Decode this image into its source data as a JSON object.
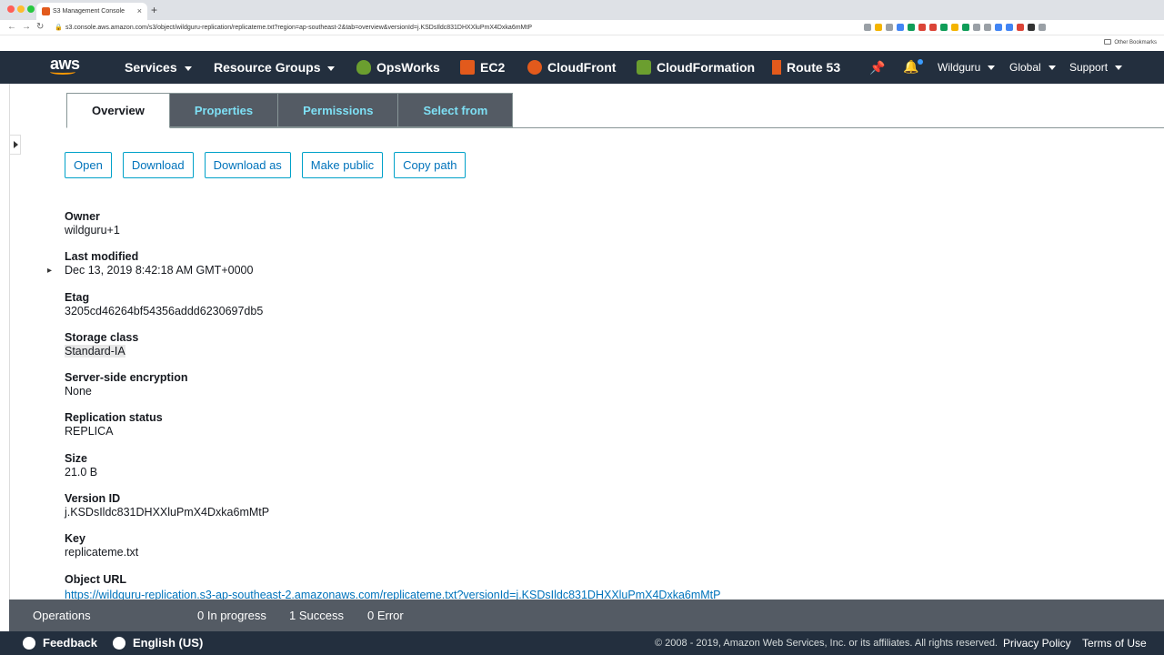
{
  "browser": {
    "tab_title": "S3 Management Console",
    "tab_close": "×",
    "new_tab": "+",
    "url": "s3.console.aws.amazon.com/s3/object/wildguru-replication/replicateme.txt?region=ap-southeast-2&tab=overview&versionId=j.KSDsIldc831DHXXluPmX4Dxka6mMtP",
    "bookmarks_label": "Other Bookmarks",
    "nav_back": "←",
    "nav_forward": "→",
    "nav_reload": "↻",
    "lock": "🔒",
    "extension_colors": [
      "#9aa0a6",
      "#f4b400",
      "#9aa0a6",
      "#4285f4",
      "#0f9d58",
      "#db4437",
      "#db4437",
      "#0f9d58",
      "#f4b400",
      "#0f9d58",
      "#9aa0a6",
      "#9aa0a6",
      "#4285f4",
      "#4285f4",
      "#db4437",
      "#333333",
      "#9aa0a6"
    ]
  },
  "aws_nav": {
    "logo_text": "aws",
    "services": "Services",
    "resource_groups": "Resource Groups",
    "shortcuts": [
      {
        "label": "OpsWorks",
        "icon": "opsworks-icon",
        "color": "#6b9e2f"
      },
      {
        "label": "EC2",
        "icon": "ec2-icon",
        "color": "#e25a1c"
      },
      {
        "label": "CloudFront",
        "icon": "cloudfront-icon",
        "color": "#e25a1c"
      },
      {
        "label": "CloudFormation",
        "icon": "cloudformation-icon",
        "color": "#6b9e2f"
      },
      {
        "label": "Route 53",
        "icon": "route53-icon",
        "color": "#e25a1c"
      }
    ],
    "pin_glyph": "📌",
    "bell_glyph": "🔔",
    "account": "Wildguru",
    "region": "Global",
    "support": "Support"
  },
  "tabs": [
    {
      "label": "Overview",
      "active": true
    },
    {
      "label": "Properties",
      "active": false
    },
    {
      "label": "Permissions",
      "active": false
    },
    {
      "label": "Select from",
      "active": false
    }
  ],
  "actions": [
    "Open",
    "Download",
    "Download as",
    "Make public",
    "Copy path"
  ],
  "properties": [
    {
      "label": "Owner",
      "value": "wildguru+1"
    },
    {
      "label": "Last modified",
      "value": "Dec 13, 2019 8:42:18 AM GMT+0000"
    },
    {
      "label": "Etag",
      "value": "3205cd46264bf54356addd6230697db5"
    },
    {
      "label": "Storage class",
      "value": "Standard-IA"
    },
    {
      "label": "Server-side encryption",
      "value": "None"
    },
    {
      "label": "Replication status",
      "value": "REPLICA"
    },
    {
      "label": "Size",
      "value": "21.0 B"
    },
    {
      "label": "Version ID",
      "value": "j.KSDsIldc831DHXXluPmX4Dxka6mMtP"
    },
    {
      "label": "Key",
      "value": "replicateme.txt"
    },
    {
      "label": "Object URL",
      "value": "https://wildguru-replication.s3-ap-southeast-2.amazonaws.com/replicateme.txt?versionId=j.KSDsIldc831DHXXluPmX4Dxka6mMtP"
    }
  ],
  "operations": {
    "label": "Operations",
    "in_progress": "0 In progress",
    "success": "1 Success",
    "error": "0 Error"
  },
  "footer": {
    "feedback": "Feedback",
    "language": "English (US)",
    "copyright": "© 2008 - 2019, Amazon Web Services, Inc. or its affiliates. All rights reserved.",
    "privacy": "Privacy Policy",
    "terms": "Terms of Use"
  }
}
